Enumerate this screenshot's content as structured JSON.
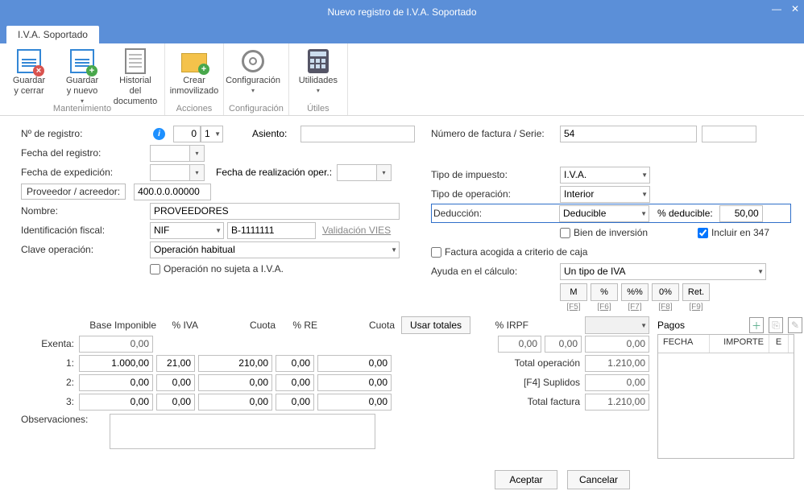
{
  "window": {
    "title": "Nuevo registro de I.V.A. Soportado"
  },
  "tab": {
    "label": "I.V.A. Soportado"
  },
  "ribbon": {
    "groups": [
      {
        "caption": "Mantenimiento",
        "items": [
          {
            "label": "Guardar y cerrar",
            "name": "guardar-cerrar",
            "icon": "ico-save ico-savex",
            "arrow": false
          },
          {
            "label": "Guardar y nuevo",
            "name": "guardar-nuevo",
            "icon": "ico-save ico-saveplus",
            "arrow": true
          },
          {
            "label": "Historial del documento",
            "name": "historial",
            "icon": "ico-doc",
            "arrow": false
          }
        ]
      },
      {
        "caption": "Acciones",
        "items": [
          {
            "label": "Crear inmovilizado",
            "name": "crear-inmov",
            "icon": "ico-folder",
            "arrow": false
          }
        ]
      },
      {
        "caption": "Configuración",
        "items": [
          {
            "label": "Configuración",
            "name": "config",
            "icon": "ico-gear",
            "arrow": true
          }
        ]
      },
      {
        "caption": "Útiles",
        "items": [
          {
            "label": "Utilidades",
            "name": "utilidades",
            "icon": "ico-calc",
            "arrow": true
          }
        ]
      }
    ]
  },
  "left": {
    "nregistro_lbl": "Nº de registro:",
    "nregistro_val": "0",
    "nregistro_serie": "1",
    "asiento_lbl": "Asiento:",
    "asiento_val": "",
    "fecha_registro_lbl": "Fecha del registro:",
    "fecha_registro_val": "",
    "fecha_exp_lbl": "Fecha de expedición:",
    "fecha_exp_val": "",
    "fecha_real_lbl": "Fecha de realización oper.:",
    "fecha_real_val": "",
    "proveedor_lbl": "Proveedor / acreedor:",
    "proveedor_val": "400.0.0.00000",
    "nombre_lbl": "Nombre:",
    "nombre_val": "PROVEEDORES",
    "idfiscal_lbl": "Identificación fiscal:",
    "idfiscal_tipo": "NIF",
    "idfiscal_num": "B-1111111",
    "vies_link": "Validación VIES",
    "claveop_lbl": "Clave operación:",
    "claveop_val": "Operación habitual",
    "no_sujeta_lbl": "Operación no sujeta a I.V.A."
  },
  "right": {
    "numfact_lbl": "Número de factura / Serie:",
    "numfact_val": "54",
    "numfact_serie": "",
    "tipo_imp_lbl": "Tipo de impuesto:",
    "tipo_imp_val": "I.V.A.",
    "tipo_op_lbl": "Tipo de operación:",
    "tipo_op_val": "Interior",
    "deduccion_lbl": "Deducción:",
    "deduccion_val": "Deducible",
    "pct_ded_lbl": "% deducible:",
    "pct_ded_val": "50,00",
    "bien_inv_lbl": "Bien de inversión",
    "incluir347_lbl": "Incluir en 347",
    "criterio_caja_lbl": "Factura acogida a criterio de caja",
    "ayuda_lbl": "Ayuda en el cálculo:",
    "ayuda_val": "Un tipo de IVA",
    "calc_btns": [
      "M",
      "%",
      "%%",
      "0%",
      "Ret."
    ],
    "calc_keys": [
      "[F5]",
      "[F6]",
      "[F7]",
      "[F8]",
      "[F9]"
    ]
  },
  "grid": {
    "headers": {
      "base": "Base Imponible",
      "iva": "% IVA",
      "cuota1": "Cuota",
      "re": "% RE",
      "cuota2": "Cuota",
      "irpf": "% IRPF"
    },
    "usar_totales": "Usar totales",
    "row_labels": {
      "exenta": "Exenta:",
      "r1": "1:",
      "r2": "2:",
      "r3": "3:"
    },
    "rows": {
      "exenta": {
        "base": "0,00"
      },
      "r1": {
        "base": "1.000,00",
        "iva": "21,00",
        "cuota1": "210,00",
        "re": "0,00",
        "cuota2": "0,00"
      },
      "r2": {
        "base": "0,00",
        "iva": "0,00",
        "cuota1": "0,00",
        "re": "0,00",
        "cuota2": "0,00"
      },
      "r3": {
        "base": "0,00",
        "iva": "0,00",
        "cuota1": "0,00",
        "re": "0,00",
        "cuota2": "0,00"
      }
    },
    "irpf_row": {
      "v1": "0,00",
      "v2": "0,00",
      "v3": "0,00"
    },
    "totals": {
      "total_op_lbl": "Total operación",
      "total_op_val": "1.210,00",
      "suplidos_lbl": "[F4] Suplidos",
      "suplidos_val": "0,00",
      "total_fact_lbl": "Total factura",
      "total_fact_val": "1.210,00"
    },
    "pagos_lbl": "Pagos",
    "pagos_headers": {
      "fecha": "FECHA",
      "importe": "IMPORTE",
      "e": "E"
    },
    "observaciones_lbl": "Observaciones:"
  },
  "buttons": {
    "aceptar": "Aceptar",
    "cancelar": "Cancelar"
  }
}
